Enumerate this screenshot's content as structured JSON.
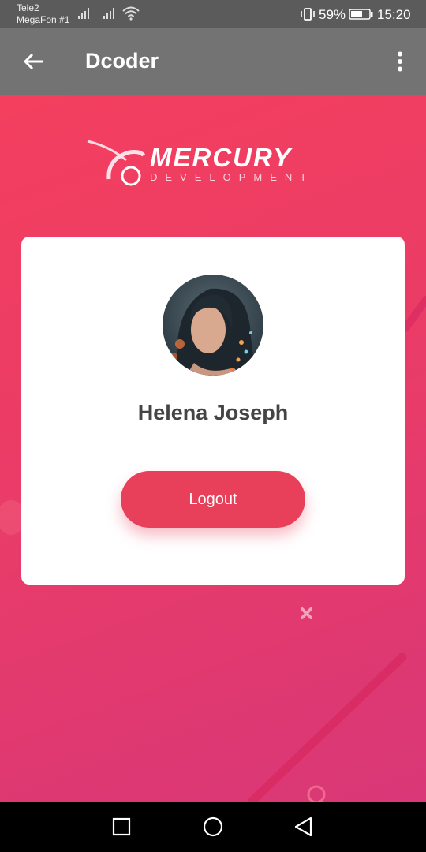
{
  "status_bar": {
    "carrier_1": "Tele2",
    "carrier_2": "MegaFon #1",
    "battery_percent": "59%",
    "time": "15:20"
  },
  "app_bar": {
    "title": "Dcoder"
  },
  "logo": {
    "main": "MERCURY",
    "sub": "DEVELOPMENT"
  },
  "profile": {
    "name": "Helena Joseph",
    "logout_label": "Logout"
  },
  "colors": {
    "accent": "#e8405a",
    "gradient_start": "#f43f5e",
    "gradient_end": "#d93778"
  }
}
